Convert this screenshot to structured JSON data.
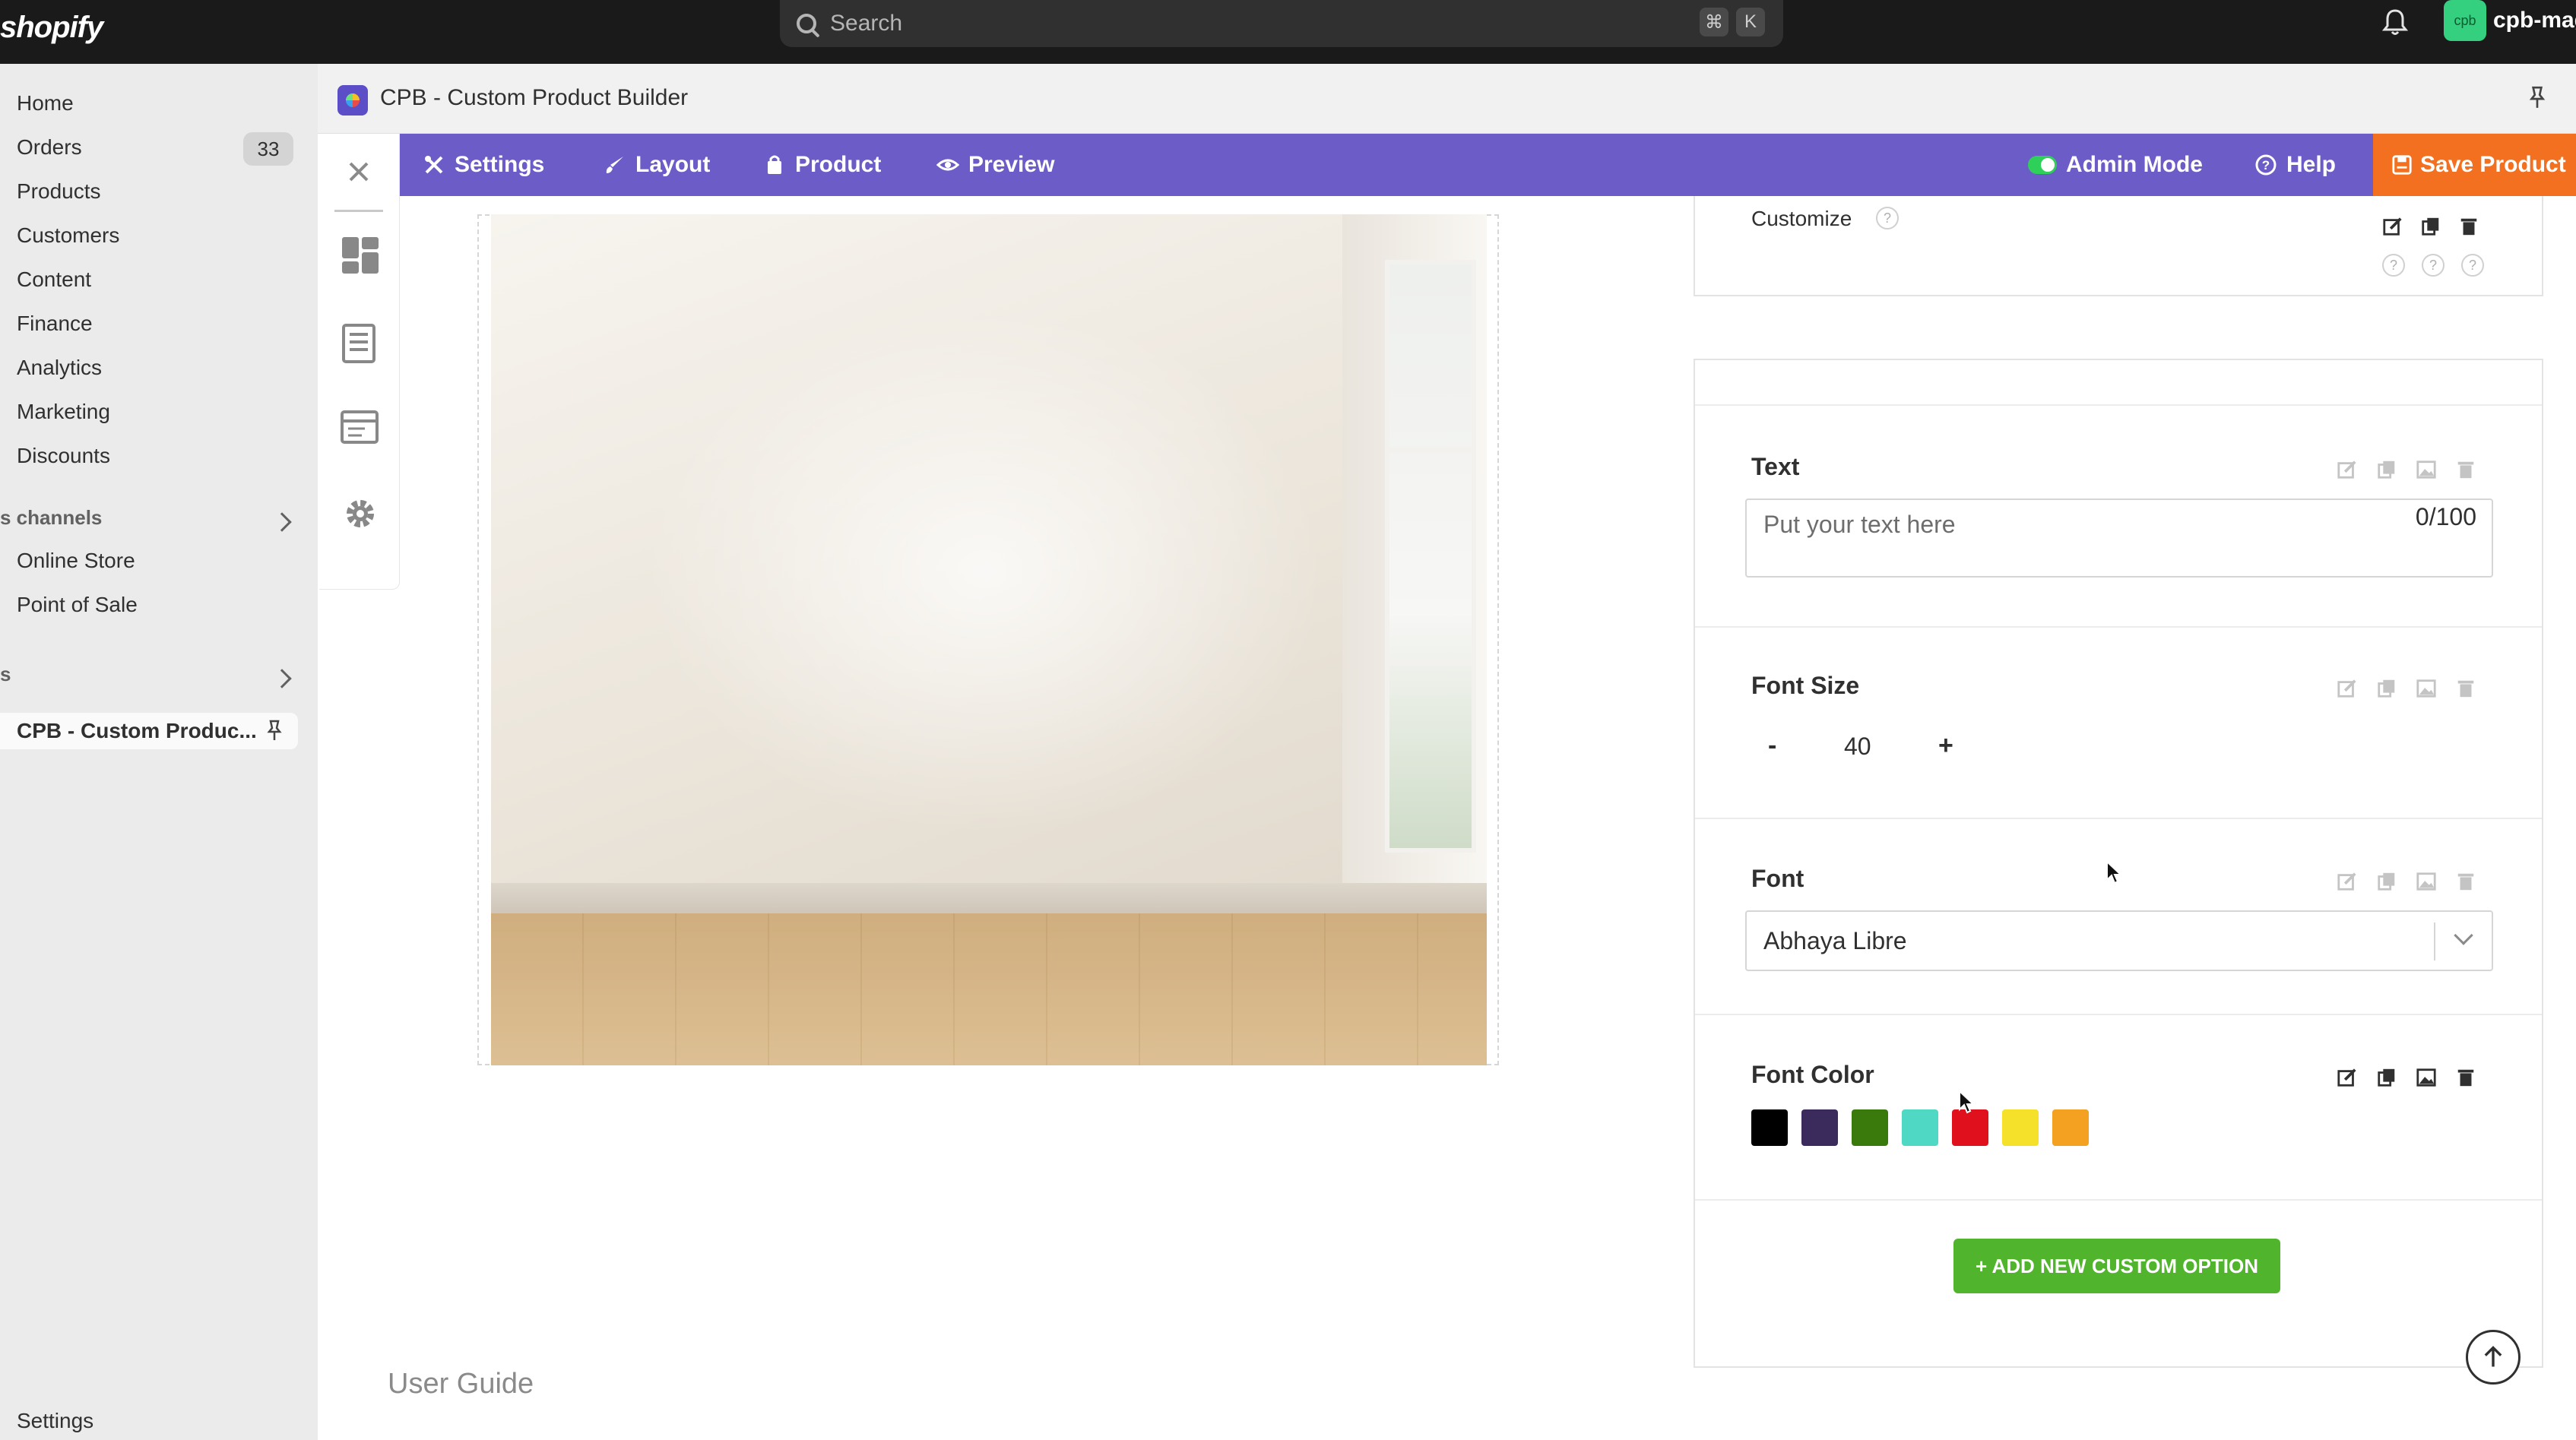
{
  "topbar": {
    "brand": "shopify",
    "search_placeholder": "Search",
    "shortcut_cmd": "⌘",
    "shortcut_key": "K",
    "avatar_initials": "cpb",
    "store_name": "cpb-mag"
  },
  "sidebar": {
    "items": [
      {
        "label": "Home"
      },
      {
        "label": "Orders",
        "badge": "33"
      },
      {
        "label": "Products"
      },
      {
        "label": "Customers"
      },
      {
        "label": "Content"
      },
      {
        "label": "Finance"
      },
      {
        "label": "Analytics"
      },
      {
        "label": "Marketing"
      },
      {
        "label": "Discounts"
      }
    ],
    "channels_label": "s channels",
    "channels": [
      {
        "label": "Online Store"
      },
      {
        "label": "Point of Sale"
      }
    ],
    "apps_label": "s",
    "active_app": "CPB - Custom Produc...",
    "settings_label": "Settings"
  },
  "app": {
    "title": "CPB - Custom Product Builder"
  },
  "toolbar": {
    "settings": "Settings",
    "layout": "Layout",
    "product": "Product",
    "preview": "Preview",
    "admin_mode": "Admin Mode",
    "help": "Help",
    "save": "Save Product"
  },
  "canvas": {
    "user_guide": "User Guide"
  },
  "panel": {
    "customize_label": "Customize",
    "help_mark": "?",
    "text_option": {
      "title": "Text",
      "placeholder": "Put your text here",
      "counter": "0/100"
    },
    "font_size_option": {
      "title": "Font Size",
      "minus": "-",
      "value": "40",
      "plus": "+"
    },
    "font_option": {
      "title": "Font",
      "selected": "Abhaya Libre"
    },
    "font_color_option": {
      "title": "Font Color",
      "swatches": [
        "#000000",
        "#3b2a5c",
        "#3a7a0c",
        "#4fd8c4",
        "#e0101c",
        "#f5e12a",
        "#f4a020"
      ]
    },
    "add_button": "+ ADD NEW CUSTOM OPTION"
  },
  "colors": {
    "topbar": "#1a1a1a",
    "toolbar": "#6c5cc7",
    "save": "#f2701f",
    "add": "#50b52c"
  }
}
